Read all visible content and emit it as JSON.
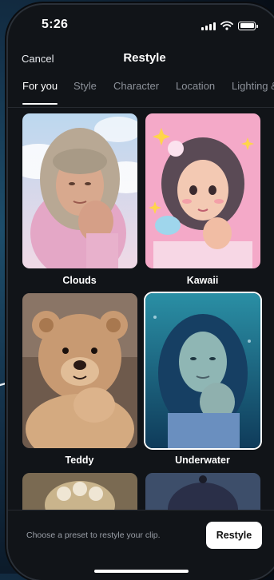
{
  "status_bar": {
    "time": "5:26"
  },
  "nav": {
    "cancel_label": "Cancel",
    "title": "Restyle"
  },
  "tabs": [
    {
      "label": "For you"
    },
    {
      "label": "Style"
    },
    {
      "label": "Character"
    },
    {
      "label": "Location"
    },
    {
      "label": "Lighting &"
    }
  ],
  "presets": [
    {
      "label": "Clouds"
    },
    {
      "label": "Kawaii"
    },
    {
      "label": "Teddy"
    },
    {
      "label": "Underwater",
      "selected": true
    },
    {
      "label": ""
    },
    {
      "label": ""
    }
  ],
  "footer": {
    "hint": "Choose a preset to restyle your clip.",
    "restyle_label": "Restyle"
  },
  "colors": {
    "background": "#111418",
    "accent": "#ffffff",
    "muted_text": "#8c9199"
  },
  "icons": [
    "signal-icon",
    "wifi-icon",
    "battery-icon"
  ]
}
